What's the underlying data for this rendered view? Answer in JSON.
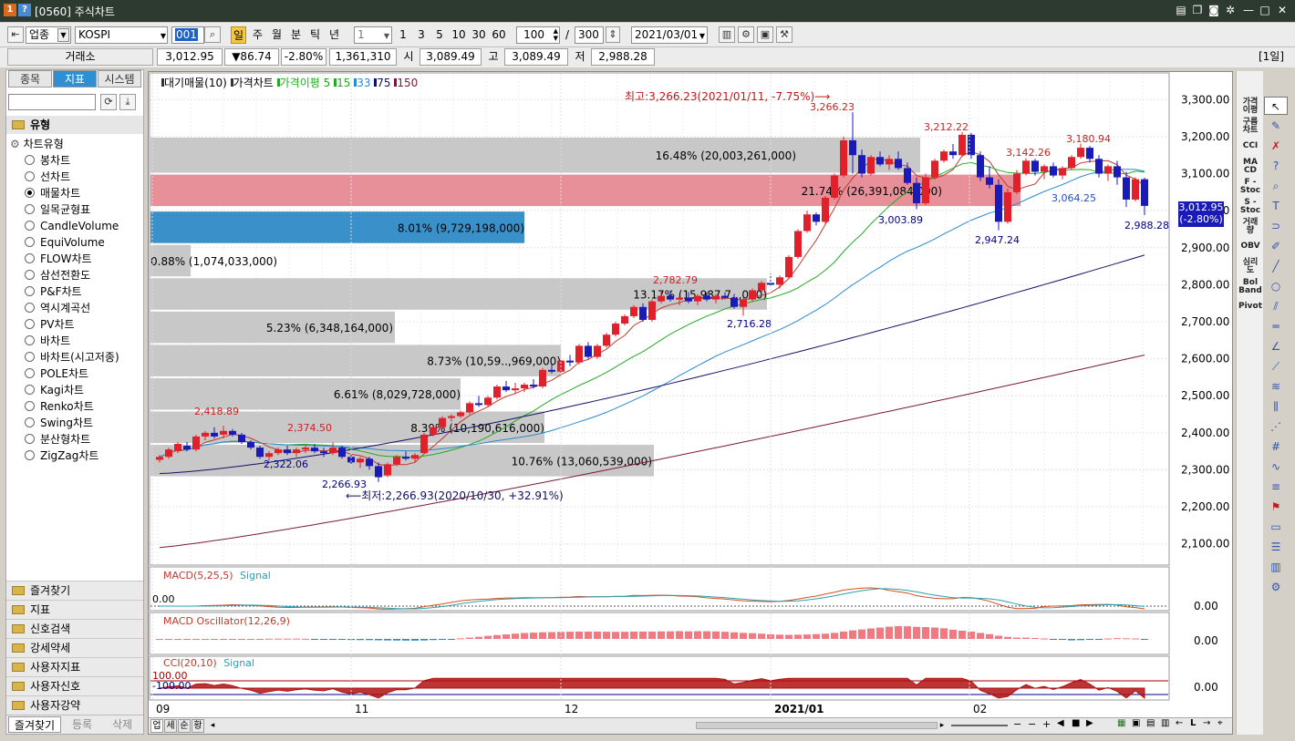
{
  "window": {
    "title": "[0560] 주식차트",
    "icon1": "1",
    "icon2": "?",
    "buttons": [
      "note-icon",
      "copy-icon",
      "camera-icon",
      "gear-icon",
      "minimize-icon",
      "maximize-icon",
      "close-icon"
    ]
  },
  "toolbar": {
    "market_select": "업종",
    "symbol": "KOSPI",
    "code": "001",
    "periods": [
      "일",
      "주",
      "월",
      "분",
      "틱",
      "년"
    ],
    "active_period": "일",
    "count_select": "1",
    "intervals": [
      "1",
      "3",
      "5",
      "10",
      "30",
      "60"
    ],
    "display_count": "100",
    "separator": "/",
    "total_count": "300",
    "date": "2021/03/01"
  },
  "quote": {
    "exchange": "거래소",
    "price": "3,012.95",
    "change": "▼86.74",
    "change_pct": "-2.80%",
    "volume": "1,361,310",
    "open_label": "시",
    "open": "3,089.49",
    "high_label": "고",
    "high": "3,089.49",
    "low_label": "저",
    "low": "2,988.28",
    "period_badge": "[1일]"
  },
  "left_panel": {
    "tabs": [
      "종목",
      "지표",
      "시스템"
    ],
    "active_tab": "지표",
    "section_title": "유형",
    "tree_root": "차트유형",
    "chart_types": [
      "봉차트",
      "선차트",
      "매물차트",
      "일목균형표",
      "CandleVolume",
      "EquiVolume",
      "FLOW차트",
      "삼선전환도",
      "P&F차트",
      "역시계곡선",
      "PV차트",
      "바차트",
      "바차트(시고저종)",
      "POLE차트",
      "Kagi차트",
      "Renko차트",
      "Swing차트",
      "분산형차트",
      "ZigZag차트"
    ],
    "selected_type": "매물차트",
    "folders": [
      "즐겨찾기",
      "지표",
      "신호검색",
      "강세약세",
      "사용자지표",
      "사용자신호",
      "사용자강약"
    ],
    "bottom_tabs": [
      "즐겨찾기",
      "등록",
      "삭제"
    ]
  },
  "chart": {
    "legend": {
      "vol_profile": "대기매물(10)",
      "price_chart": "가격차트",
      "ma_label": "가격이평 5",
      "ma15": "15",
      "ma33": "33",
      "ma75": "75",
      "ma150": "150"
    },
    "colors": {
      "up": "#e0202a",
      "down": "#1a1ab8",
      "ma5": "#c0392b",
      "ma15": "#22aa22",
      "ma33": "#2a8ad0",
      "ma75": "#111166",
      "ma150": "#7a1a3a"
    },
    "annotations": {
      "high_note": "최고:3,266.23(2021/01/11, -7.75%)⟶",
      "low_note": "⟵최저:2,266.93(2020/10/30, +32.91%)",
      "labels": [
        {
          "text": "3,266.23",
          "color": "#d02020"
        },
        {
          "text": "3,212.22",
          "color": "#d02020"
        },
        {
          "text": "3,142.26",
          "color": "#d02020"
        },
        {
          "text": "3,180.94",
          "color": "#d02020"
        },
        {
          "text": "3,003.89",
          "color": "#000080"
        },
        {
          "text": "2,947.24",
          "color": "#000080"
        },
        {
          "text": "3,064.25",
          "color": "#2050c0"
        },
        {
          "text": "2,988.28",
          "color": "#000080"
        },
        {
          "text": "2,782.79",
          "color": "#d02020"
        },
        {
          "text": "2,716.28",
          "color": "#000080"
        },
        {
          "text": "2,418.89",
          "color": "#d02020"
        },
        {
          "text": "2,374.50",
          "color": "#d02020"
        },
        {
          "text": "2,322.06",
          "color": "#000080"
        },
        {
          "text": "2,266.93",
          "color": "#000080"
        }
      ]
    },
    "current_price_tag": "3,012.95",
    "current_pct_tag": "(-2.80%)",
    "x_labels": [
      "09",
      "11",
      "12",
      "2021/01",
      "02"
    ],
    "macd": {
      "title": "MACD(5,25,5)",
      "signal": "Signal",
      "left_value": "0.00",
      "right_value": "0.00"
    },
    "osc": {
      "title": "MACD Oscillator(12,26,9)",
      "right_value": "0.00"
    },
    "cci": {
      "title": "CCI(20,10)",
      "signal": "Signal",
      "level_hi": "100.00",
      "level_lo": "-100.00",
      "right_value": "0.00"
    },
    "bottom_tabs": [
      "업",
      "세",
      "순",
      "황"
    ]
  },
  "chart_data": {
    "type": "candlestick",
    "ylim": [
      2050,
      3350
    ],
    "y_ticks": [
      "3,300.00",
      "3,200.00",
      "3,100.00",
      "3,000.00",
      "2,900.00",
      "2,800.00",
      "2,700.00",
      "2,600.00",
      "2,500.00",
      "2,400.00",
      "2,300.00",
      "2,200.00",
      "2,100.00"
    ],
    "volume_profile": [
      {
        "low": 3100,
        "high": 3200,
        "pct_label": "16.48% (20,003,261,000)",
        "color": "#c8c8c8"
      },
      {
        "low": 3010,
        "high": 3100,
        "pct_label": "21.74% (26,391,084,000)",
        "color": "#e8909a"
      },
      {
        "low": 2910,
        "high": 3000,
        "pct_label": "8.01% (9,729,198,000)",
        "color": "#3a90c8"
      },
      {
        "low": 2820,
        "high": 2910,
        "pct_label": "0.88% (1,074,033,000)",
        "color": "#c8c8c8"
      },
      {
        "low": 2730,
        "high": 2820,
        "pct_label": "13.17% (15,987,7..,000)",
        "color": "#c8c8c8"
      },
      {
        "low": 2640,
        "high": 2730,
        "pct_label": "5.23% (6,348,164,000)",
        "color": "#c8c8c8"
      },
      {
        "low": 2550,
        "high": 2640,
        "pct_label": "8.73% (10,59..,969,000)",
        "color": "#c8c8c8"
      },
      {
        "low": 2460,
        "high": 2550,
        "pct_label": "6.61% (8,029,728,000)",
        "color": "#c8c8c8"
      },
      {
        "low": 2370,
        "high": 2460,
        "pct_label": "8.39% (10,190,616,000)",
        "color": "#c8c8c8"
      },
      {
        "low": 2280,
        "high": 2370,
        "pct_label": "10.76% (13,060,539,000)",
        "color": "#c8c8c8"
      }
    ],
    "ohlc": [
      [
        2327,
        2340,
        2320,
        2335
      ],
      [
        2335,
        2360,
        2330,
        2355
      ],
      [
        2350,
        2375,
        2345,
        2370
      ],
      [
        2365,
        2375,
        2350,
        2355
      ],
      [
        2355,
        2395,
        2350,
        2390
      ],
      [
        2390,
        2405,
        2380,
        2400
      ],
      [
        2400,
        2415,
        2385,
        2390
      ],
      [
        2395,
        2419,
        2385,
        2405
      ],
      [
        2405,
        2410,
        2390,
        2395
      ],
      [
        2395,
        2400,
        2370,
        2375
      ],
      [
        2375,
        2380,
        2355,
        2360
      ],
      [
        2360,
        2365,
        2330,
        2335
      ],
      [
        2335,
        2350,
        2325,
        2345
      ],
      [
        2345,
        2360,
        2340,
        2355
      ],
      [
        2355,
        2365,
        2340,
        2345
      ],
      [
        2345,
        2360,
        2335,
        2355
      ],
      [
        2355,
        2365,
        2345,
        2360
      ],
      [
        2360,
        2370,
        2345,
        2350
      ],
      [
        2350,
        2360,
        2335,
        2345
      ],
      [
        2345,
        2374,
        2340,
        2360
      ],
      [
        2360,
        2365,
        2330,
        2335
      ],
      [
        2335,
        2345,
        2315,
        2320
      ],
      [
        2320,
        2335,
        2305,
        2330
      ],
      [
        2330,
        2335,
        2300,
        2310
      ],
      [
        2310,
        2320,
        2267,
        2280
      ],
      [
        2285,
        2320,
        2280,
        2315
      ],
      [
        2315,
        2340,
        2310,
        2335
      ],
      [
        2335,
        2350,
        2325,
        2330
      ],
      [
        2330,
        2345,
        2320,
        2340
      ],
      [
        2345,
        2400,
        2345,
        2395
      ],
      [
        2395,
        2420,
        2390,
        2415
      ],
      [
        2415,
        2445,
        2410,
        2440
      ],
      [
        2440,
        2450,
        2430,
        2445
      ],
      [
        2445,
        2460,
        2440,
        2455
      ],
      [
        2455,
        2485,
        2450,
        2480
      ],
      [
        2480,
        2500,
        2470,
        2475
      ],
      [
        2475,
        2500,
        2470,
        2495
      ],
      [
        2495,
        2530,
        2490,
        2525
      ],
      [
        2525,
        2540,
        2510,
        2515
      ],
      [
        2515,
        2535,
        2505,
        2520
      ],
      [
        2520,
        2535,
        2510,
        2530
      ],
      [
        2530,
        2545,
        2520,
        2525
      ],
      [
        2525,
        2575,
        2520,
        2570
      ],
      [
        2570,
        2585,
        2560,
        2565
      ],
      [
        2565,
        2600,
        2560,
        2595
      ],
      [
        2595,
        2610,
        2580,
        2590
      ],
      [
        2590,
        2640,
        2585,
        2635
      ],
      [
        2635,
        2645,
        2600,
        2605
      ],
      [
        2605,
        2640,
        2600,
        2635
      ],
      [
        2635,
        2670,
        2630,
        2665
      ],
      [
        2665,
        2700,
        2660,
        2695
      ],
      [
        2695,
        2720,
        2690,
        2715
      ],
      [
        2715,
        2745,
        2710,
        2740
      ],
      [
        2740,
        2750,
        2700,
        2705
      ],
      [
        2705,
        2760,
        2700,
        2755
      ],
      [
        2755,
        2783,
        2750,
        2770
      ],
      [
        2770,
        2785,
        2755,
        2760
      ],
      [
        2760,
        2770,
        2745,
        2765
      ],
      [
        2765,
        2780,
        2750,
        2755
      ],
      [
        2755,
        2775,
        2745,
        2770
      ],
      [
        2770,
        2780,
        2755,
        2760
      ],
      [
        2760,
        2775,
        2750,
        2770
      ],
      [
        2770,
        2780,
        2760,
        2765
      ],
      [
        2765,
        2775,
        2735,
        2740
      ],
      [
        2740,
        2765,
        2716,
        2760
      ],
      [
        2760,
        2790,
        2755,
        2785
      ],
      [
        2785,
        2810,
        2780,
        2805
      ],
      [
        2805,
        2830,
        2795,
        2800
      ],
      [
        2800,
        2825,
        2790,
        2820
      ],
      [
        2820,
        2880,
        2815,
        2875
      ],
      [
        2875,
        2950,
        2870,
        2945
      ],
      [
        2945,
        3000,
        2940,
        2990
      ],
      [
        2990,
        2995,
        2960,
        2970
      ],
      [
        2970,
        3040,
        2965,
        3035
      ],
      [
        3035,
        3100,
        3030,
        3095
      ],
      [
        3095,
        3200,
        3090,
        3190
      ],
      [
        3190,
        3266,
        3100,
        3150
      ],
      [
        3150,
        3165,
        3090,
        3100
      ],
      [
        3100,
        3150,
        3095,
        3145
      ],
      [
        3145,
        3160,
        3120,
        3125
      ],
      [
        3125,
        3150,
        3110,
        3140
      ],
      [
        3140,
        3160,
        3110,
        3115
      ],
      [
        3115,
        3130,
        3070,
        3075
      ],
      [
        3075,
        3090,
        3004,
        3020
      ],
      [
        3020,
        3100,
        3015,
        3090
      ],
      [
        3090,
        3140,
        3085,
        3135
      ],
      [
        3135,
        3165,
        3130,
        3160
      ],
      [
        3160,
        3180,
        3140,
        3150
      ],
      [
        3150,
        3212,
        3145,
        3205
      ],
      [
        3205,
        3210,
        3140,
        3150
      ],
      [
        3150,
        3160,
        3080,
        3090
      ],
      [
        3090,
        3120,
        3060,
        3070
      ],
      [
        3070,
        3085,
        2947,
        2970
      ],
      [
        2970,
        3060,
        2965,
        3050
      ],
      [
        3050,
        3110,
        3045,
        3100
      ],
      [
        3100,
        3142,
        3095,
        3135
      ],
      [
        3135,
        3140,
        3095,
        3105
      ],
      [
        3105,
        3125,
        3085,
        3120
      ],
      [
        3120,
        3130,
        3090,
        3095
      ],
      [
        3095,
        3120,
        3085,
        3115
      ],
      [
        3115,
        3150,
        3110,
        3145
      ],
      [
        3145,
        3181,
        3140,
        3170
      ],
      [
        3170,
        3175,
        3130,
        3140
      ],
      [
        3140,
        3150,
        3090,
        3100
      ],
      [
        3100,
        3125,
        3080,
        3120
      ],
      [
        3120,
        3135,
        3070,
        3090
      ],
      [
        3090,
        3105,
        3010,
        3030
      ],
      [
        3030,
        3090,
        3025,
        3085
      ],
      [
        3085,
        3089,
        2988,
        3013
      ]
    ],
    "ma75_start_end": [
      2290,
      2880
    ],
    "ma150_start_end": [
      2090,
      2610
    ]
  }
}
